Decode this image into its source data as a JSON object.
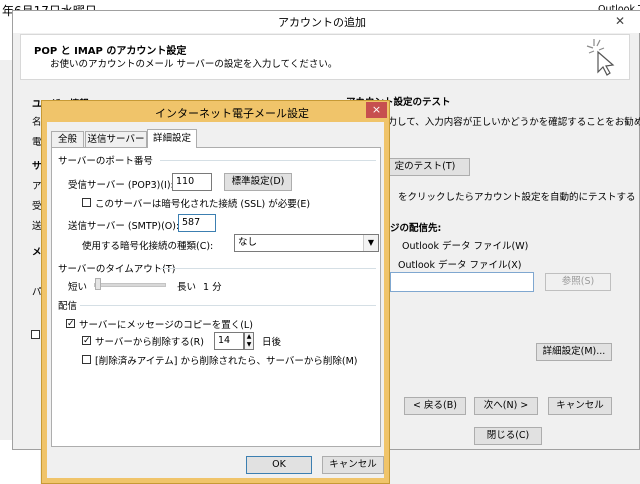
{
  "behind": {
    "top_date": "年6月17日水曜日",
    "top_right_app": "Outlook T"
  },
  "account_window": {
    "title": "アカウントの追加",
    "heading": "POP と IMAP のアカウント設定",
    "subheading": "お使いのアカウントのメール サーバーの設定を入力してください。",
    "left_frag_user": "ユーザー情報",
    "left_frags": [
      "名",
      "電",
      "サ",
      "ア",
      "受",
      "送",
      "メ",
      "パ"
    ],
    "test_section": "アカウント設定のテスト",
    "test_desc": "入力して、入力内容が正しいかどうかを確認することをお勧め",
    "test_button": "定のテスト(T)",
    "auto_test_desc": "をクリックしたらアカウント設定を自動的にテストする",
    "delivery_label": "ジの配信先:",
    "radio_new": "Outlook データ ファイル(W)",
    "radio_existing": "Outlook データ ファイル(X)",
    "browse_button": "参照(S)",
    "more_settings_button": "詳細設定(M)...",
    "back_button": "< 戻る(B)",
    "next_button": "次へ(N) >",
    "cancel_button": "キャンセル",
    "close_button": "閉じる(C)"
  },
  "inet_dialog": {
    "title": "インターネット電子メール設定",
    "close_glyph": "×",
    "tabs": [
      {
        "label": "全般"
      },
      {
        "label": "送信サーバー"
      },
      {
        "label": "詳細設定"
      }
    ],
    "port_group": "サーバーのポート番号",
    "incoming_label": "受信サーバー (POP3)(I):",
    "incoming_value": "110",
    "default_button": "標準設定(D)",
    "ssl_label": "このサーバーは暗号化された接続 (SSL) が必要(E)",
    "outgoing_label": "送信サーバー (SMTP)(O):",
    "outgoing_value": "587",
    "encryption_label": "使用する暗号化接続の種類(C):",
    "encryption_value": "なし",
    "timeout_group": "サーバーのタイムアウト(T)",
    "timeout_short": "短い",
    "timeout_long": "長い",
    "timeout_value": "1 分",
    "delivery_group": "配信",
    "leave_copy_label": "サーバーにメッセージのコピーを置く(L)",
    "leave_copy_checked": true,
    "remove_after_label": "サーバーから削除する(R)",
    "remove_after_checked": true,
    "remove_after_days": "14",
    "days_unit": "日後",
    "remove_deleted_label": "[削除済みアイテム] から削除されたら、サーバーから削除(M)",
    "remove_deleted_checked": false,
    "ok_button": "OK",
    "cancel_button": "キャンセル"
  },
  "colors": {
    "dialog_border": "#e8b64a",
    "window_bg": "#f0f0f0",
    "button_bg": "#e1e1e1",
    "close_red": "#c74f4f"
  }
}
